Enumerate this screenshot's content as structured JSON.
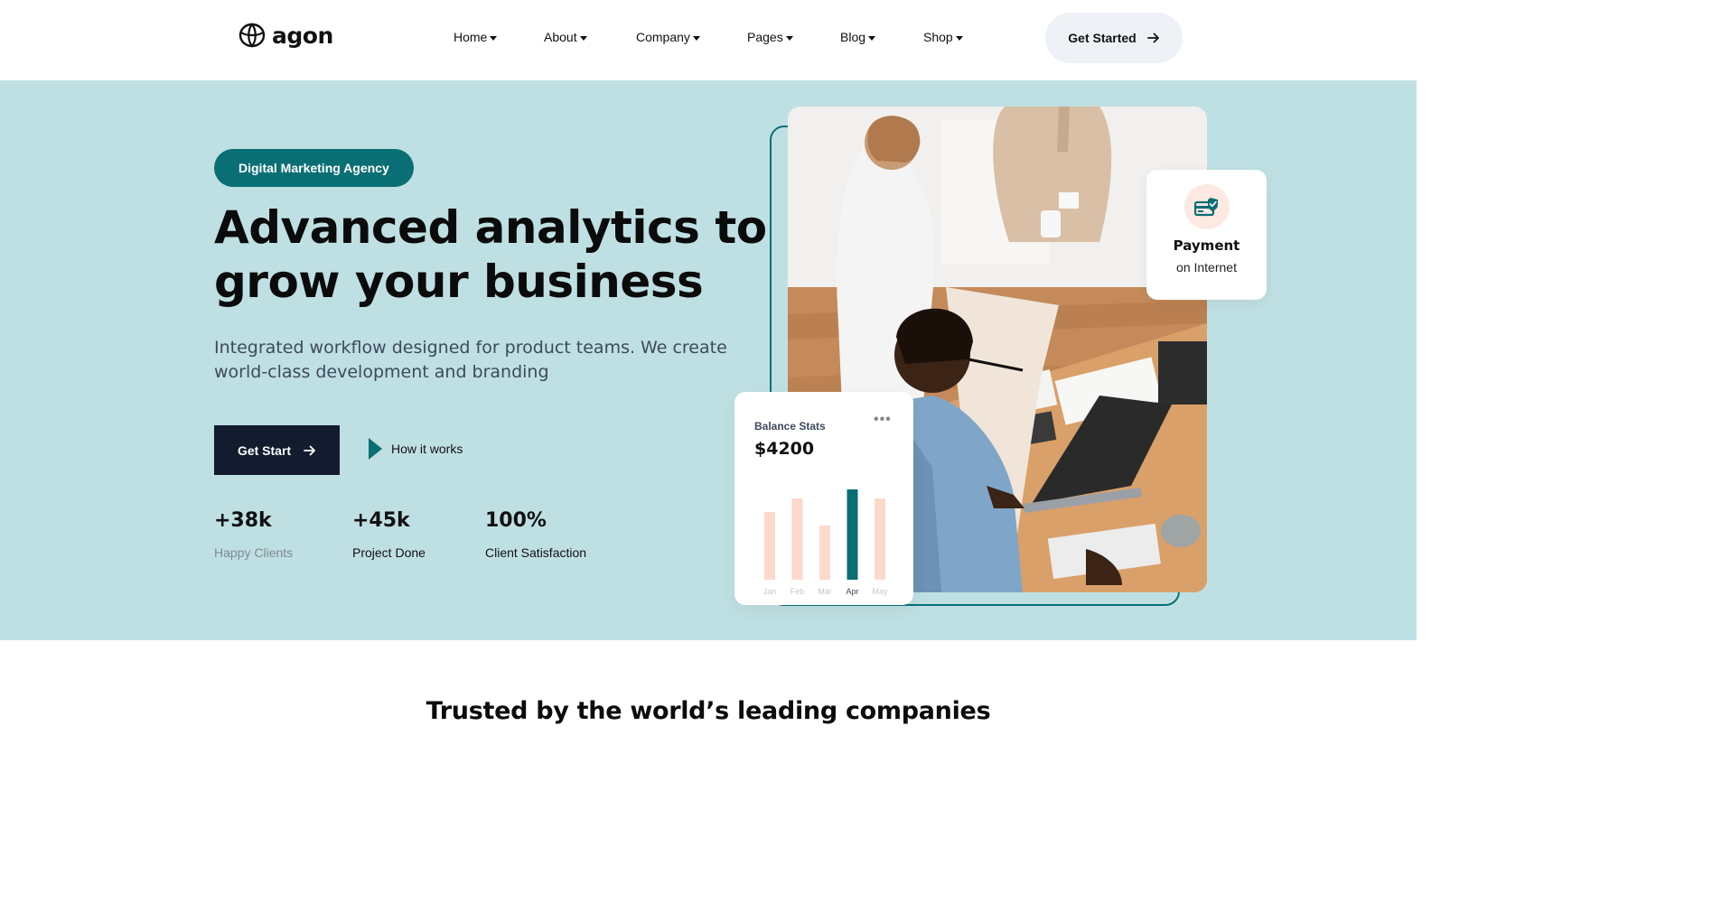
{
  "brand": {
    "name": "agon",
    "logo_icon": "leaf-globe-icon"
  },
  "nav": {
    "items": [
      {
        "label": "Home"
      },
      {
        "label": "About"
      },
      {
        "label": "Company"
      },
      {
        "label": "Pages"
      },
      {
        "label": "Blog"
      },
      {
        "label": "Shop"
      }
    ],
    "cta_label": "Get Started",
    "cta_icon": "arrow-right-icon"
  },
  "hero": {
    "badge": "Digital Marketing Agency",
    "headline_line1": "Advanced analytics to",
    "headline_line2": "grow your business",
    "subtext": "Integrated workflow designed for product teams. We create world-class development and branding",
    "primary_button": "Get Start",
    "secondary_button": "How it works",
    "stats": [
      {
        "value": "+38k",
        "label": "Happy Clients"
      },
      {
        "value": "+45k",
        "label": "Project Done"
      },
      {
        "value": "100%",
        "label": "Client Satisfaction"
      }
    ]
  },
  "payment_card": {
    "title": "Payment",
    "subtitle": "on Internet",
    "icon": "card-check-icon"
  },
  "balance_card": {
    "title": "Balance Stats",
    "amount": "$4200",
    "more_icon": "more-dots-icon",
    "chart_data": {
      "type": "bar",
      "categories": [
        "Jan",
        "Feb",
        "Mar",
        "Apr",
        "May"
      ],
      "values": [
        75,
        90,
        60,
        100,
        90
      ],
      "highlight": "Apr",
      "colors": {
        "default": "#fdd9cc",
        "highlight": "#0a6f74"
      }
    }
  },
  "trusted": {
    "heading": "Trusted by the world’s leading companies"
  },
  "colors": {
    "accent": "#0a6f74",
    "hero_bg": "#bfe0e3",
    "dark_button": "#131b2e",
    "cta_light": "#eef1f5"
  }
}
